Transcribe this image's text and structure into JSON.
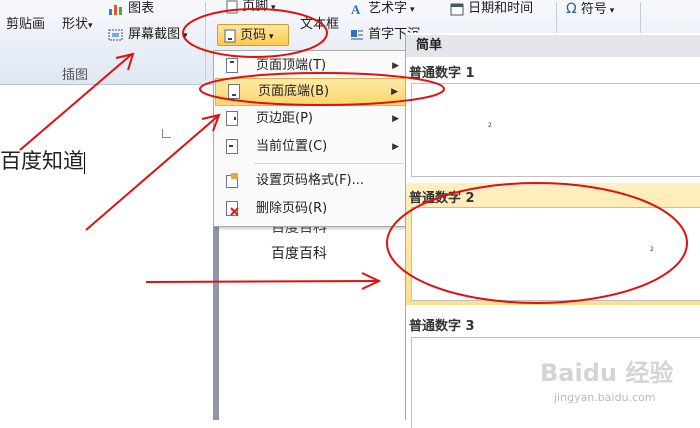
{
  "ribbon": {
    "paste_label": "剪贴画",
    "shapes_label": "形状",
    "chart_label": "图表",
    "screenshot_label": "屏幕截图",
    "group_label": "插图",
    "header_label": "页脚",
    "page_number_label": "页码",
    "textbox_label": "文本框",
    "wordart_label": "艺术字",
    "firstdrop_label": "首字下沉",
    "date_label": "日期和时间",
    "symbol_label": "符号"
  },
  "document": {
    "text": "百度知道",
    "text2": "百度百科",
    "text3": "百度百科"
  },
  "menu": {
    "items": [
      {
        "label": "页面顶端(T)"
      },
      {
        "label": "页面底端(B)"
      },
      {
        "label": "页边距(P)"
      },
      {
        "label": "当前位置(C)"
      },
      {
        "label": "设置页码格式(F)..."
      },
      {
        "label": "删除页码(R)"
      }
    ]
  },
  "gallery": {
    "section": "简单",
    "items": [
      {
        "label": "普通数字 1",
        "number": "2"
      },
      {
        "label": "普通数字 2",
        "number": "2"
      },
      {
        "label": "普通数字 3"
      }
    ]
  },
  "watermark": {
    "logo": "Baidu 经验",
    "url": "jingyan.baidu.com"
  },
  "colors": {
    "highlight": "#fbd66a",
    "annotation": "#e01010"
  }
}
